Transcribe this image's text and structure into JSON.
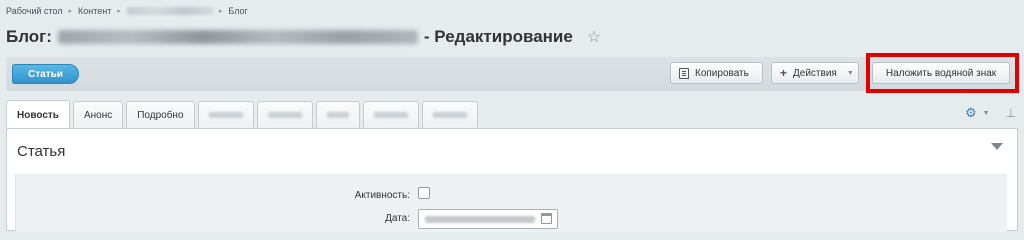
{
  "breadcrumbs": [
    "Рабочий стол",
    "Контент",
    "Блог"
  ],
  "title": {
    "prefix": "Блог:",
    "suffix": "- Редактирование",
    "star": "☆"
  },
  "toolbar": {
    "articles_label": "Статьи",
    "copy_label": "Копировать",
    "actions_label": "Действия",
    "watermark_label": "Наложить водяной знак"
  },
  "tabs": [
    {
      "label": "Новость",
      "active": true
    },
    {
      "label": "Анонс"
    },
    {
      "label": "Подробно"
    }
  ],
  "panel": {
    "title": "Статья",
    "active_label": "Активность:",
    "date_label": "Дата:"
  },
  "icons": {
    "gear": "⚙",
    "pin": "📌",
    "copy": "copy-icon",
    "calendar": "calendar-icon"
  },
  "colors": {
    "accent": "#3293cb",
    "highlight": "#e00000"
  }
}
